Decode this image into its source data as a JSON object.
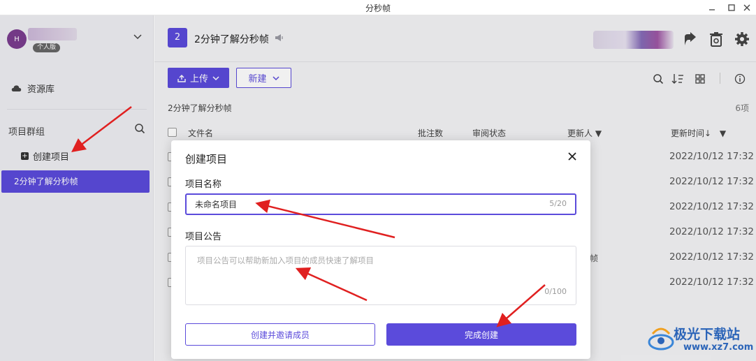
{
  "window": {
    "title": "分秒帧"
  },
  "sidebar": {
    "user_badge": "个人版",
    "avatar_initial": "H",
    "library_label": "资源库",
    "group_title": "项目群组",
    "create_project_label": "创建项目",
    "project_item": "2分钟了解分秒帧"
  },
  "header": {
    "project_number": "2",
    "project_title": "2分钟了解分秒帧"
  },
  "toolbar": {
    "upload_label": "上传",
    "new_label": "新建"
  },
  "content": {
    "breadcrumb": "2分钟了解分秒帧",
    "count": "6项",
    "columns": {
      "filename": "文件名",
      "comments": "批注数",
      "review": "审阅状态",
      "updater": "更新人",
      "updated": "更新时间↓"
    },
    "row_times": [
      "2022/10/12 17:32",
      "2022/10/12 17:32",
      "2022/10/12 17:32",
      "2022/10/12 17:32",
      "2022/10/12 17:32",
      "2022/10/12 17:32"
    ],
    "row_edge_text": "帧"
  },
  "dialog": {
    "title": "创建项目",
    "name_label": "项目名称",
    "name_value": "未命名项目",
    "name_count": "5/20",
    "notice_label": "项目公告",
    "notice_placeholder": "项目公告可以帮助新加入项目的成员快速了解项目",
    "notice_count": "0/100",
    "invite_button": "创建并邀请成员",
    "done_button": "完成创建"
  },
  "watermark": {
    "text": "极光下载站",
    "url": "www.xz7.com"
  },
  "colors": {
    "accent": "#5b4bdb",
    "annotation": "#e02020"
  }
}
